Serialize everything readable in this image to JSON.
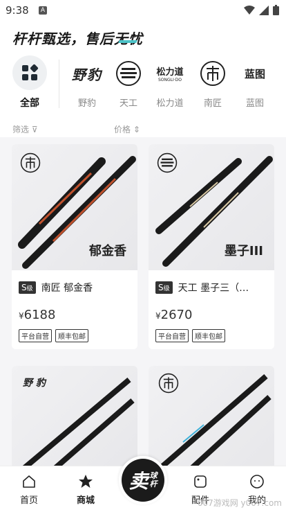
{
  "status": {
    "time": "9:38",
    "badge": "A"
  },
  "header": {
    "slogan": "杆杆甄选，售后无忧"
  },
  "brands": {
    "all_label": "全部",
    "items": [
      {
        "logo_text": "野豹",
        "label": "野豹"
      },
      {
        "logo_text": "天工",
        "label": "天工"
      },
      {
        "logo_text": "松力道",
        "logo_sub": "SONGLI·DO",
        "label": "松力道"
      },
      {
        "logo_text": "南匠",
        "label": "南匠"
      },
      {
        "logo_text": "蓝图",
        "label": "蓝图"
      }
    ]
  },
  "filter": {
    "filter_label": "筛选",
    "price_label": "价格"
  },
  "products": [
    {
      "grade": "S",
      "grade_suffix": "级",
      "title": "南匠 郁金香",
      "currency": "¥",
      "price": "6188",
      "cue_name": "郁金香",
      "tags": [
        "平台自营",
        "顺丰包邮"
      ]
    },
    {
      "grade": "S",
      "grade_suffix": "级",
      "title": "天工 墨子三（…",
      "currency": "¥",
      "price": "2670",
      "cue_name": "墨子III",
      "tags": [
        "平台自营",
        "顺丰包邮"
      ]
    }
  ],
  "partial_products": [
    {
      "brand": "野 豹"
    },
    {
      "brand": "南匠"
    }
  ],
  "nav": {
    "home": "首页",
    "mall": "商城",
    "sell_big": "卖",
    "sell_small1": "球",
    "sell_small2": "杆",
    "parts": "配件",
    "mine": "我的"
  },
  "watermark": "007游戏网 y007.com"
}
